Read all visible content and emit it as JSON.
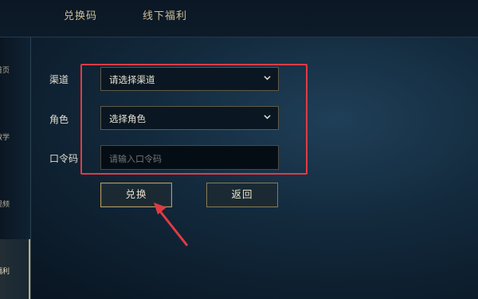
{
  "top_tabs": [
    "兑换码",
    "线下福利"
  ],
  "sidebar": {
    "items": [
      "首页",
      "教学",
      "视频",
      "福利"
    ],
    "active_index": 3
  },
  "form": {
    "channel": {
      "label": "渠道",
      "value": "请选择渠道"
    },
    "role": {
      "label": "角色",
      "value": "选择角色"
    },
    "code": {
      "label": "口令码",
      "placeholder": "请输入口令码"
    }
  },
  "buttons": {
    "redeem": "兑换",
    "back": "返回"
  },
  "annotation": {
    "color": "#e03b44"
  }
}
